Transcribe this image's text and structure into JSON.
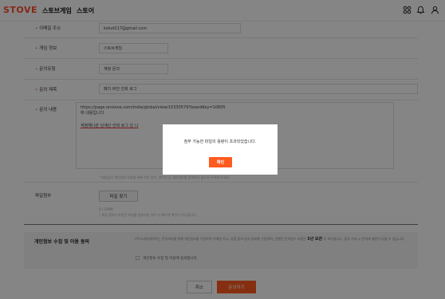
{
  "header": {
    "logo": "STOVE",
    "nav": [
      "스토브게임",
      "스토어"
    ],
    "icons": [
      "grid-apps-icon",
      "bell-icon",
      "user-icon"
    ]
  },
  "form": {
    "email": {
      "label": "이메일 주소",
      "value": "kolud217@gmail.com"
    },
    "game": {
      "label": "게임 정보",
      "value": "스토브게임"
    },
    "type": {
      "label": "문의유형",
      "value": "계정 문의"
    },
    "title": {
      "label": "문의 제목",
      "value": "패더 버전 안희 로그"
    },
    "content": {
      "label": "문의 내용",
      "lines": [
        "https://page.onstove.com/indie/global/view/10330579?boardKey=10605",
        "애 내용입니다",
        "계정해나관 남계산 안희 로그 있 니"
      ],
      "hint": "* 회원님의 개인정보 보호를 위해 주민 번호, 연락처 등 개인정보를 입력하지 않도록 주의해 주세요."
    },
    "file": {
      "label": "파일첨부",
      "button": "파일 찾기",
      "count": "0 / 20MB",
      "hint": "* 게임 캡쳐가 포함된 파일을 첨부하실 경우 더 빠르게 확인이 가능합니다."
    }
  },
  "consent": {
    "title": "개인정보 수집 및 이용 동의",
    "text_before": "(주)스마일게이트는 문의처리를 위해 개인정보를 수집하며 이메일 주소, 상품 정보 등의 정보를 수집하며, 진행된 문의접수 내용은",
    "text_bold": "3년 보관",
    "text_after": "후 파기됩니다. 동의 거부 시 문의에 제한이 있을 수 있습니다.",
    "checkbox_label": "개인정보 수집 및 이용에 동의합니다."
  },
  "buttons": {
    "cancel": "취소",
    "submit": "문의하기"
  },
  "modal": {
    "message": "첨부 가능한 파일의 용량이 초과되었습니다.",
    "ok": "확인"
  },
  "colors": {
    "accent": "#ff5a1f",
    "logo": "#ff4d2d",
    "overlay": "rgba(0,0,0,0.48)"
  }
}
